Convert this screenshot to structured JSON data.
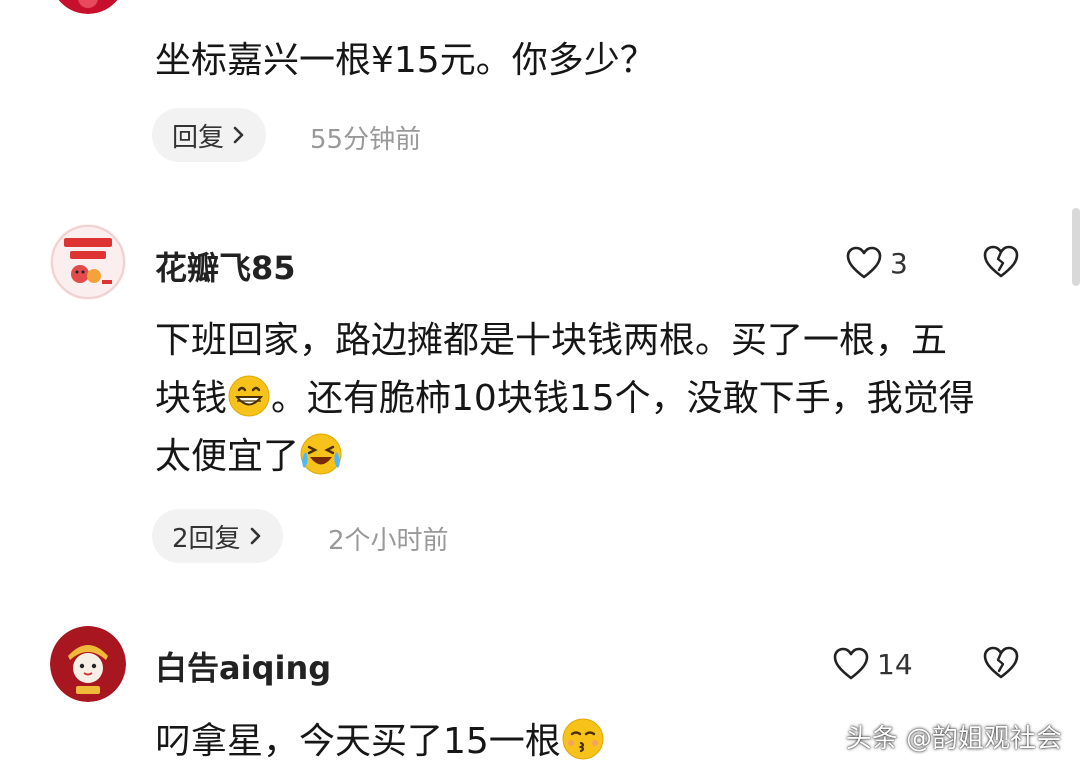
{
  "colors": {
    "text_primary": "#161616",
    "text_secondary": "#999999",
    "pill_bg": "#f2f2f2",
    "emoji_yellow": "#f7c21a"
  },
  "comments": [
    {
      "text_lines": [
        "坐标嘉兴一根¥15元。你多少？"
      ],
      "reply_label": "回复",
      "timestamp": "55分钟前"
    },
    {
      "username": "花瓣飞85",
      "avatar_icon": "avatar-fortune-icon",
      "like_count": "3",
      "text_line1": "下班回家，路边摊都是十块钱两根。买了一根，五",
      "text_line2_a": "块钱",
      "text_line2_b": "。还有脆柿10块钱15个，没敢下手，我觉得",
      "text_line3": "太便宜了",
      "emoji_1": "grin-emoji",
      "emoji_2": "laugh-cry-emoji",
      "reply_label": "2回复",
      "timestamp": "2个小时前"
    },
    {
      "username": "白告aiqing",
      "avatar_icon": "avatar-tiger-icon",
      "like_count": "14",
      "text_line1": "叼拿星，今天买了15一根",
      "emoji_1": "kissing-emoji"
    }
  ],
  "watermark": "头条 @韵姐观社会"
}
